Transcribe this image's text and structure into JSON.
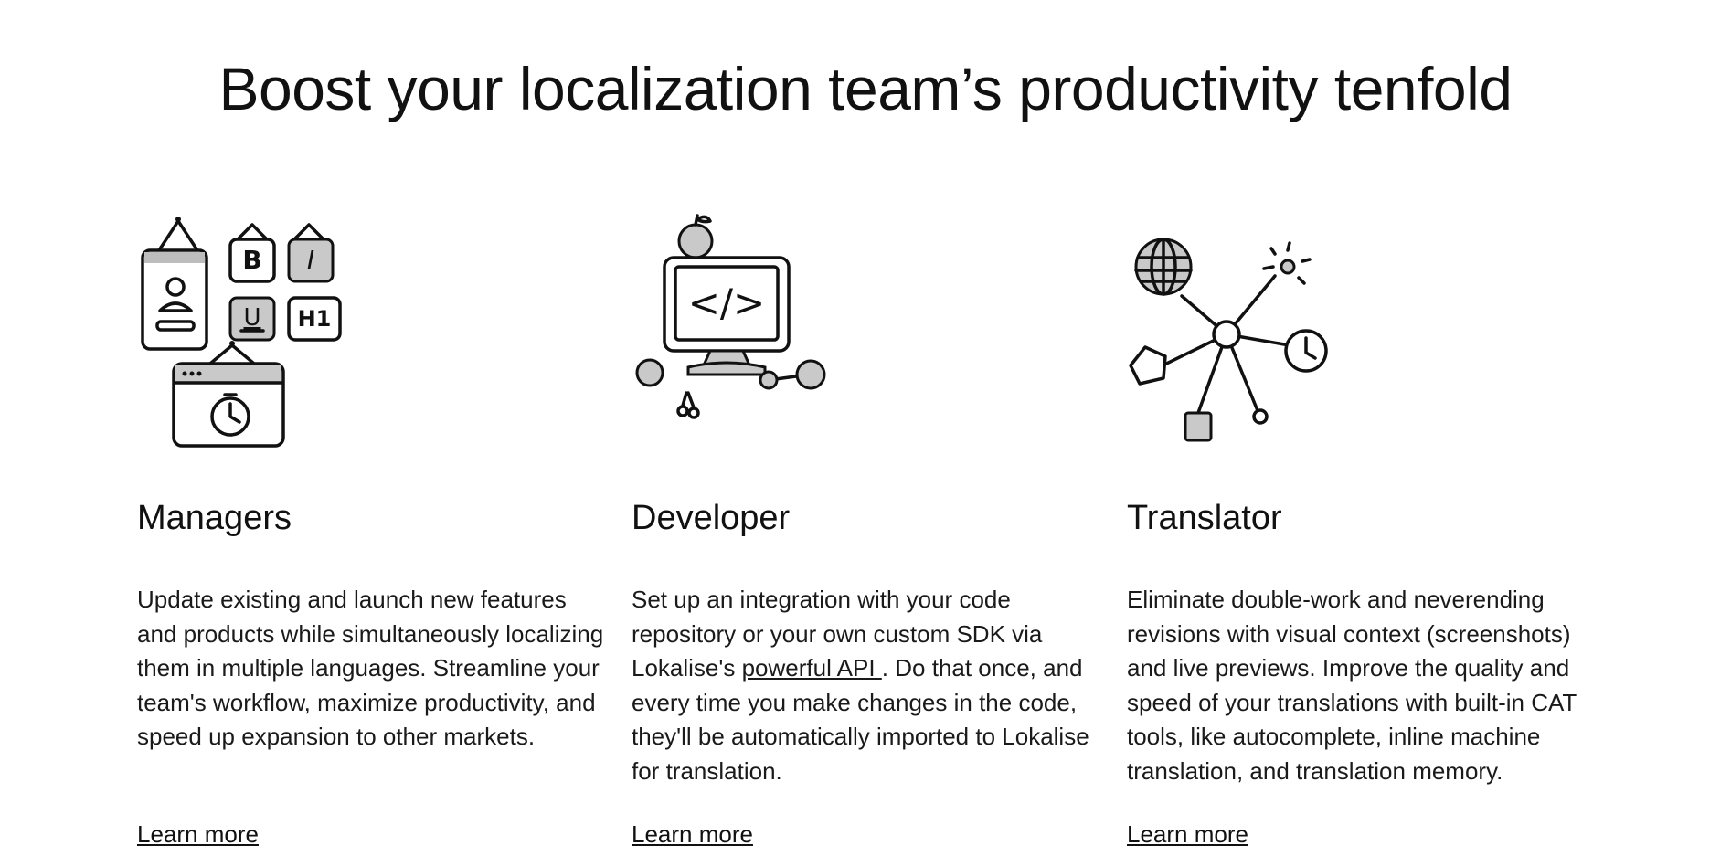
{
  "headline": "Boost your localization team’s productivity tenfold",
  "columns": [
    {
      "title": "Managers",
      "description": "Update existing and launch new features and products while simultaneously localizing them in multiple languages. Streamline your team's workflow, maximize productivity, and speed up expansion to other markets.",
      "learn_more": "Learn more",
      "icon": "manager-tools-illustration",
      "icon_labels": {
        "bold": "B",
        "italic": "I",
        "underline": "U",
        "heading": "H1"
      }
    },
    {
      "title": "Developer",
      "description_before": "Set up an integration with your code repository or your own custom SDK via Lokalise's ",
      "description_link": "powerful API ",
      "description_after": ". Do that once, and every time you make changes in the code, they'll be automatically imported to Lokalise for translation.",
      "learn_more": "Learn more",
      "icon": "developer-computer-illustration",
      "icon_code": "</>"
    },
    {
      "title": "Translator",
      "description": "Eliminate double-work and neverending revisions with visual context (screenshots) and live previews. Improve the quality and speed of your translations with built-in CAT tools, like autocomplete, inline machine translation, and translation memory.",
      "learn_more": "Learn more",
      "icon": "translator-network-illustration"
    }
  ]
}
